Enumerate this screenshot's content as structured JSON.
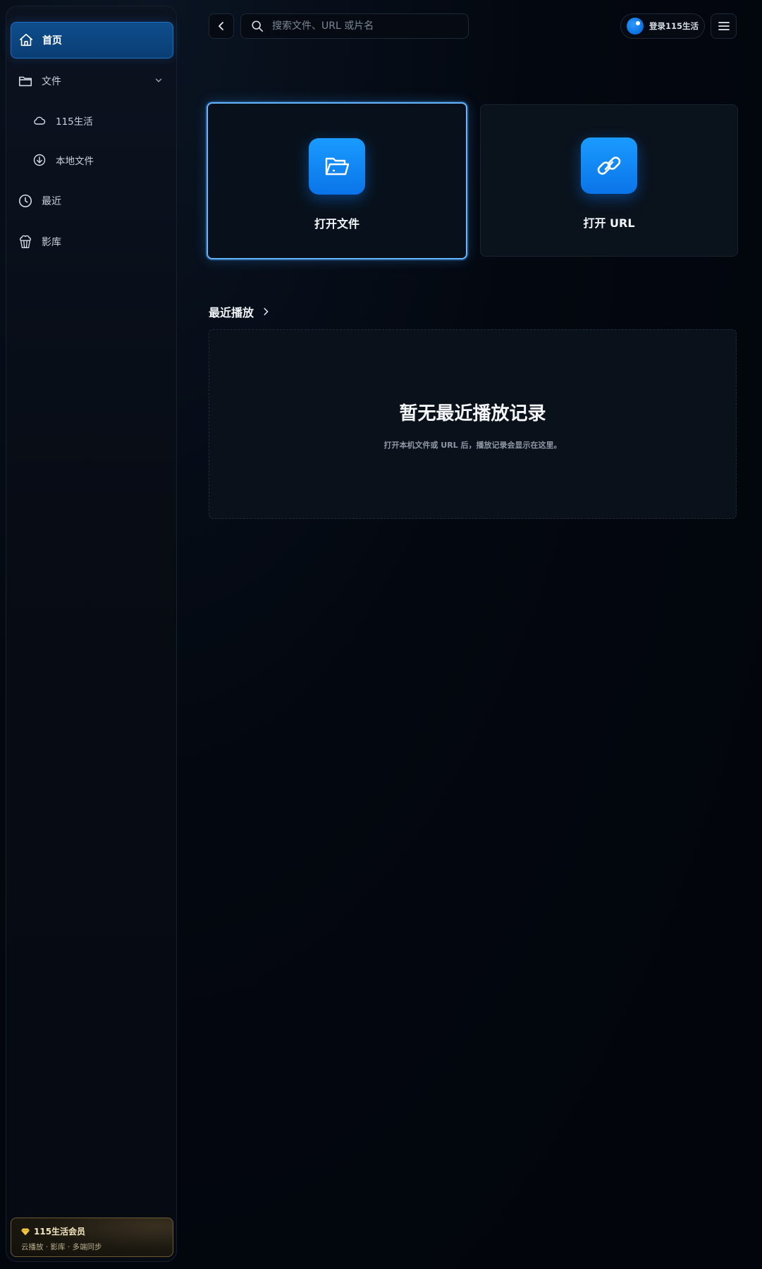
{
  "sidebar": {
    "items": [
      {
        "label": "首页",
        "icon": "home-icon",
        "active": true
      },
      {
        "label": "文件",
        "icon": "folder-icon",
        "expanded": true
      },
      {
        "label": "115生活",
        "icon": "cloud-icon",
        "sub": true
      },
      {
        "label": "本地文件",
        "icon": "download-circle-icon",
        "sub": true
      },
      {
        "label": "最近",
        "icon": "clock-icon"
      },
      {
        "label": "影库",
        "icon": "popcorn-icon"
      }
    ],
    "member": {
      "title": "115生活会员",
      "subtitle": "云播放 · 影库 · 多端同步",
      "icon": "diamond-icon"
    }
  },
  "topbar": {
    "search_placeholder": "搜索文件、URL 或片名",
    "login_label": "登录115生活"
  },
  "actions": {
    "open_file": "打开文件",
    "open_url": "打开 URL"
  },
  "recent": {
    "title": "最近播放",
    "empty_title": "暂无最近播放记录",
    "empty_desc": "打开本机文件或 URL 后，播放记录会显示在这里。"
  },
  "colors": {
    "accent": "#0a74e8",
    "accent_light": "#67b7ff",
    "background": "#03070f",
    "gold": "#f2e4be"
  }
}
